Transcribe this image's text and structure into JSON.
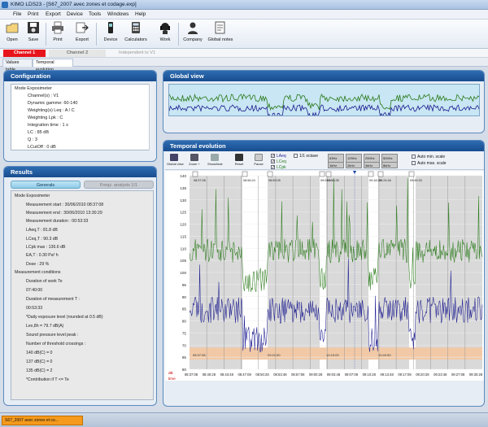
{
  "window": {
    "title": "KIMO LDS23 - [S67_2007 avec zones et codage.exp]"
  },
  "menu": [
    "File",
    "Print",
    "Export",
    "Device",
    "Tools",
    "Windows",
    "Help"
  ],
  "toolbar": [
    "Open",
    "Save",
    "Print",
    "Export",
    "Device",
    "Calculators",
    "Work",
    "Company",
    "Global notes"
  ],
  "channels": {
    "channel1": "Channel 1",
    "channel2": "Channel 2",
    "independent": "Independent to V1"
  },
  "view_tabs": [
    "Values table",
    "Temporal evolution"
  ],
  "configuration": {
    "title": "Configuration",
    "lines": [
      "Mode Exposimeter",
      "Channel(s) : V1",
      "Dynamic gamme: 60-140",
      "Weighting(s) Leq : A / C",
      "Weighting Lpk : C",
      "Integration time : 1 s",
      "LC : 85 dB",
      "Q : 3",
      "LCutOff : 0 dB"
    ]
  },
  "results": {
    "title": "Results",
    "tabs": [
      "Generals",
      "Freqz. analysis 1/1"
    ],
    "lines": [
      "Mode Exposimeter",
      "Measurement start : 30/06/2010 08:37:08",
      "Measurement end : 30/06/2010 13:30:29",
      "Measurement duration : 00:53:33",
      "LAeq,T : 81.8 dB",
      "LCeq,T : 90.3 dB",
      "LCpk max : 136.6 dB",
      "EA,T : 0.30 Pa² h",
      "Dose : 29 %",
      "Measurement conditions",
      "Duration of work Te",
      "07:40:00",
      "Duration of measurement T :",
      "00:53:33",
      "*Daily exposure level (rounded at 0.5 dB)",
      "Lex,8h = 79.7 dB(A)",
      "Sound pressure level peak :",
      "Number of threshold crossings :",
      "140 dB(C) = 0",
      "137 dB(C) = 0",
      "135 dB(C) = 2",
      "*Contribution if T <= Te"
    ]
  },
  "global_view": {
    "title": "Global view"
  },
  "temporal": {
    "title": "Temporal evolution",
    "buttons": [
      "Global view",
      "Zoom +",
      "Show/hide",
      "Reset",
      "Pause"
    ],
    "checkboxes": [
      "LAeq",
      "LCeq",
      "LCpk"
    ],
    "octave": "1/1 octave",
    "bands": [
      "63Hz",
      "125Hz",
      "250Hz",
      "500Hz",
      "1kHz",
      "2kHz",
      "4kHz",
      "8kHz"
    ],
    "auto_min": "Auto min. scale",
    "auto_max": "Auto max. scale",
    "y_ticks": [
      "140",
      "135",
      "130",
      "125",
      "120",
      "115",
      "110",
      "105",
      "100",
      "95",
      "90",
      "85",
      "80",
      "75",
      "70",
      "65",
      "60"
    ],
    "x_ticks": [
      "08:37:08",
      "08:40:28",
      "08:43:48",
      "08:47:08",
      "08:50:28",
      "08:53:48",
      "08:57:08",
      "09:00:28",
      "09:03:48",
      "09:07:08",
      "09:10:28",
      "09:13:48",
      "09:17:08",
      "09:20:28",
      "09:23:48",
      "09:27:08",
      "09:30:28"
    ],
    "cursor_times": [
      "08:37:08",
      "08:56:24",
      "08:59:05",
      "09:03:10",
      "09:16:35",
      "09:18:20",
      "09:24:46",
      "09:49:33"
    ],
    "bottom_times": [
      "08:37:08",
      "09:21:50",
      "10:15:09",
      "10:49:50"
    ],
    "unit": "dB",
    "time_label": "time"
  },
  "taskbar": {
    "item": "S67_2007 avec zones et co..."
  },
  "colors": {
    "laeq": "#2a7a1a",
    "lceq": "#1a1a8f",
    "lcpk": "#7fc96b",
    "channel1": "#e8141b"
  }
}
